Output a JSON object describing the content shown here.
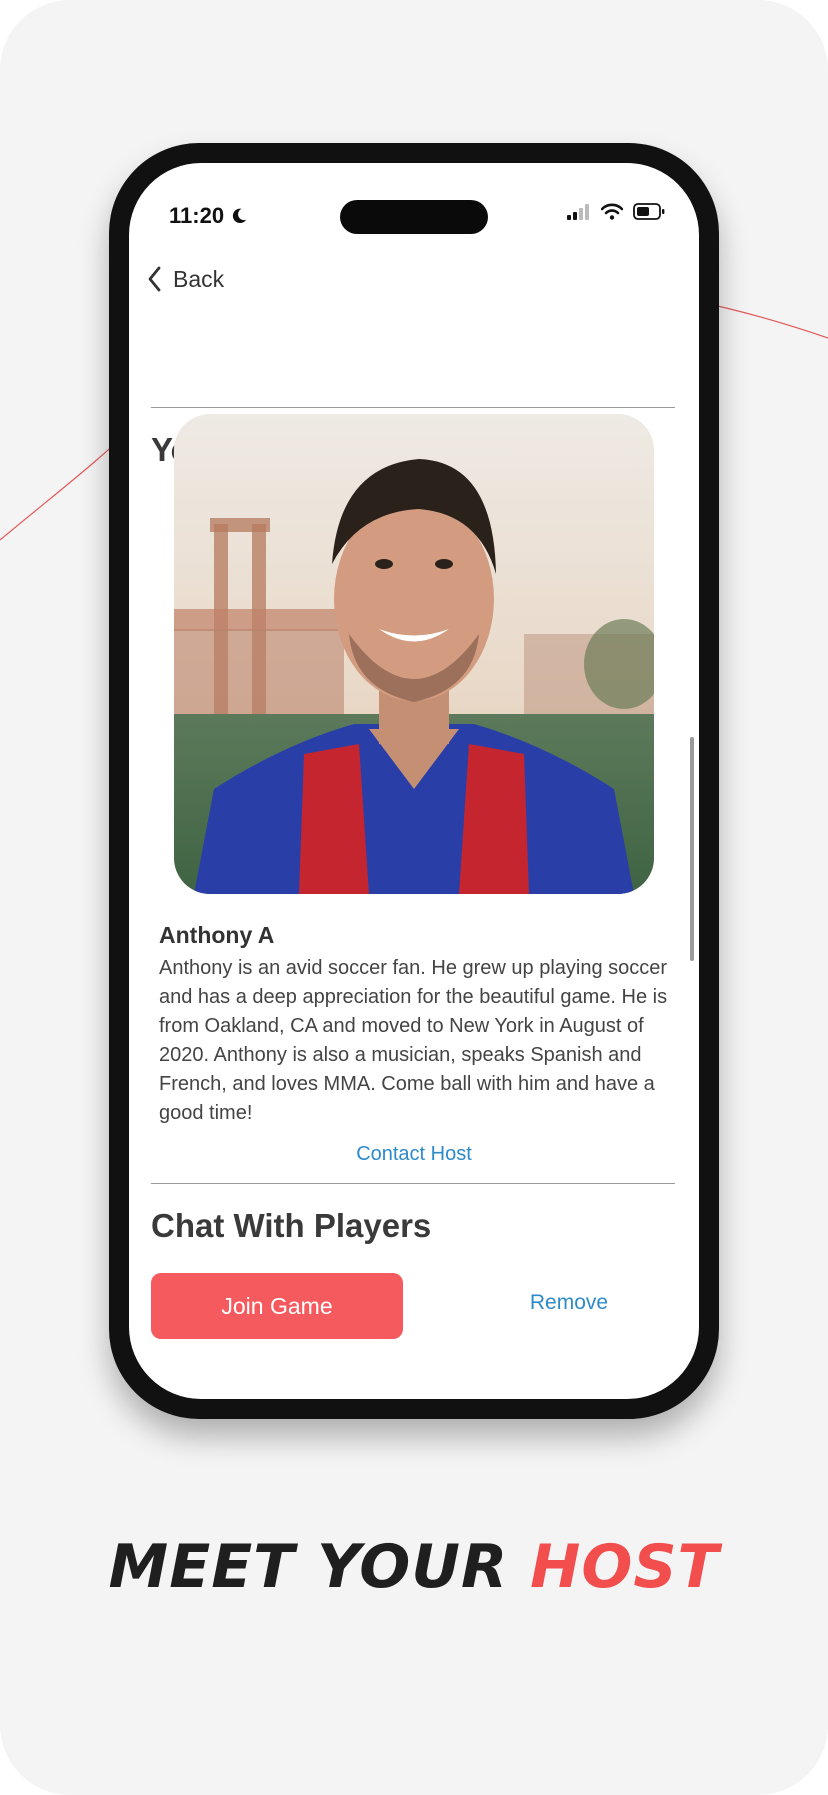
{
  "status_bar": {
    "time": "11:20",
    "icons": [
      "moon-icon",
      "signal-icon",
      "wifi-icon",
      "battery-icon"
    ]
  },
  "nav": {
    "back_label": "Back",
    "back_icon": "chevron-left-icon"
  },
  "host_section": {
    "title": "Your Host",
    "photo_alt": "Host photo",
    "name": "Anthony A",
    "bio": "Anthony is an avid soccer fan. He grew up playing soccer and has a deep appreciation for the beautiful game. He is from Oakland, CA and moved to New York in August of 2020. Anthony is also a musician, speaks Spanish and French, and loves MMA. Come ball with him and have a good time!",
    "contact_label": "Contact Host"
  },
  "chat_section": {
    "title": "Chat With Players"
  },
  "actions": {
    "join_label": "Join Game",
    "remove_label": "Remove"
  },
  "promo": {
    "headline_part1": "MEET YOUR ",
    "headline_part2": "HOST"
  },
  "colors": {
    "accent": "#f55a5f",
    "link": "#2e8bc9",
    "headline_accent": "#f24e4e",
    "background": "#f4f4f4"
  }
}
